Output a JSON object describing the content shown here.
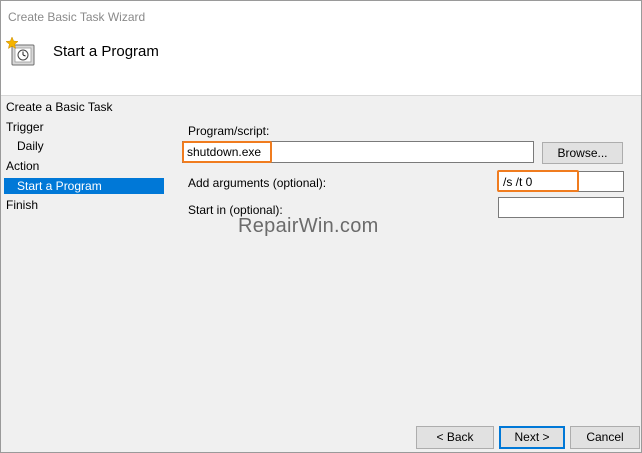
{
  "window": {
    "title": "Create Basic Task Wizard"
  },
  "header": {
    "title": "Start a Program",
    "icon": "task-scheduler-icon"
  },
  "nav": {
    "items": [
      {
        "label": "Create a Basic Task",
        "selected": false
      },
      {
        "label": "Trigger",
        "selected": false
      },
      {
        "label": "Daily",
        "selected": false
      },
      {
        "label": "Action",
        "selected": false
      },
      {
        "label": "Start a Program",
        "selected": true
      },
      {
        "label": "Finish",
        "selected": false
      }
    ]
  },
  "form": {
    "program_label": "Program/script:",
    "program_value": "shutdown.exe",
    "browse_label": "Browse...",
    "arguments_label": "Add arguments (optional):",
    "arguments_value": "/s /t 0",
    "startin_label": "Start in (optional):",
    "startin_value": ""
  },
  "watermark": "RepairWin.com",
  "footer": {
    "back_label": "< Back",
    "next_label": "Next >",
    "cancel_label": "Cancel"
  },
  "colors": {
    "selection": "#0078d7",
    "highlight": "#f07c1f"
  }
}
